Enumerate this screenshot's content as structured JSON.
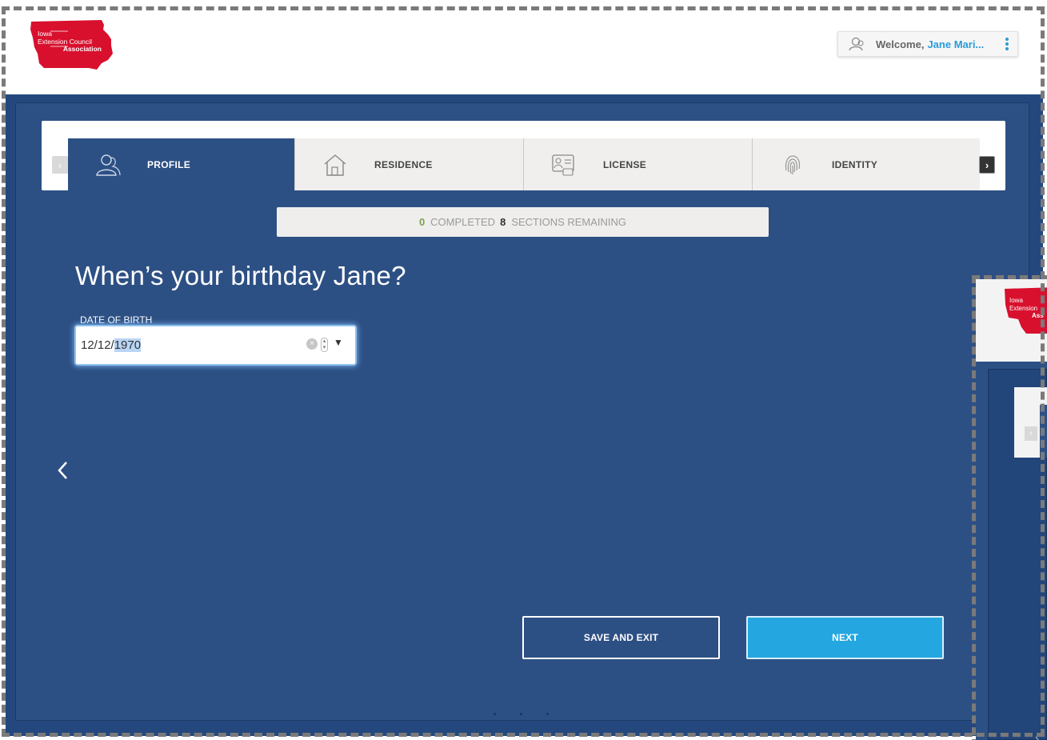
{
  "header": {
    "logo": {
      "line1": "Iowa",
      "line2": "Extension Council",
      "line3": "Association"
    },
    "welcome_label": "Welcome,",
    "user_name": "Jane Mari..."
  },
  "tabs": [
    {
      "label": "PROFILE",
      "icon": "profile-icon",
      "active": true
    },
    {
      "label": "RESIDENCE",
      "icon": "house-icon",
      "active": false
    },
    {
      "label": "LICENSE",
      "icon": "license-card-icon",
      "active": false
    },
    {
      "label": "IDENTITY",
      "icon": "fingerprint-icon",
      "active": false
    }
  ],
  "progress": {
    "completed_count": "0",
    "completed_label": "COMPLETED",
    "remaining_count": "8",
    "remaining_label": "SECTIONS REMAINING"
  },
  "question": "When’s your birthday Jane?",
  "dob": {
    "label": "DATE OF BIRTH",
    "value_prefix": "12/12/",
    "value_selected": "1970"
  },
  "buttons": {
    "save_exit": "SAVE AND EXIT",
    "next": "NEXT"
  },
  "mini_preview": {
    "logo_line1": "Iowa",
    "logo_line2": "Extension",
    "logo_line3": "Ass"
  },
  "colors": {
    "primary_blue": "#2d5084",
    "accent_blue": "#24a7e0",
    "logo_red": "#d8102e",
    "completed_green": "#7da24b"
  }
}
